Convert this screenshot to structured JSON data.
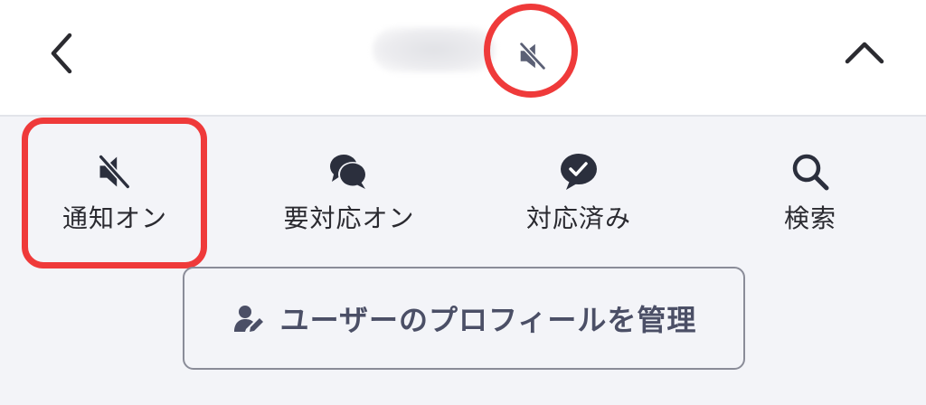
{
  "header": {
    "back_icon": "chevron-left-icon",
    "mute_icon": "speaker-muted-icon",
    "collapse_icon": "chevron-up-icon"
  },
  "actions": [
    {
      "label": "通知オン",
      "icon": "speaker-muted-icon"
    },
    {
      "label": "要対応オン",
      "icon": "chat-bubbles-icon"
    },
    {
      "label": "対応済み",
      "icon": "check-bubble-icon"
    },
    {
      "label": "検索",
      "icon": "search-icon"
    }
  ],
  "profile_button": {
    "label": "ユーザーのプロフィールを管理",
    "icon": "user-edit-icon"
  },
  "colors": {
    "highlight": "#ef3a3a",
    "icon_dark": "#2b2f3d",
    "icon_muted": "#5b6075",
    "button_text": "#4b4f66"
  }
}
